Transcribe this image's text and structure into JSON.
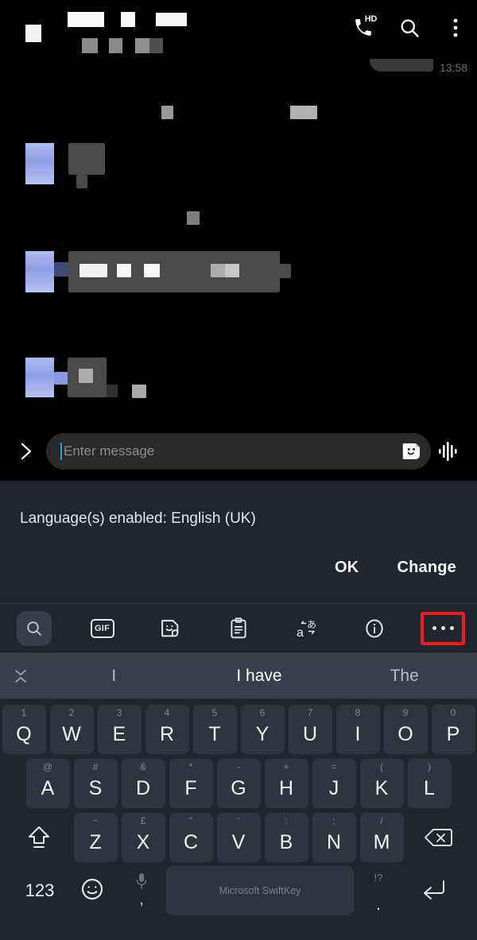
{
  "app": {
    "name": "messaging-app",
    "header": {
      "title_censored": true,
      "subtitle_censored": true,
      "icons": [
        {
          "name": "call-hd-icon",
          "badge": "HD"
        },
        {
          "name": "search-icon"
        },
        {
          "name": "overflow-menu-icon"
        }
      ]
    },
    "conversation": {
      "timestamp": "13:58",
      "messages_censored": true
    },
    "composer": {
      "expand_label": "›",
      "placeholder": "Enter message",
      "value": "",
      "sticker_icon": "sticker-icon",
      "voice_icon": "voice-waveform-icon"
    }
  },
  "keyboard": {
    "name": "Microsoft SwiftKey",
    "language_banner": {
      "message": "Language(s) enabled: English (UK)",
      "ok_label": "OK",
      "change_label": "Change"
    },
    "toolbar": [
      {
        "name": "search-icon",
        "label": "Search",
        "active": true,
        "highlighted": false
      },
      {
        "name": "gif-icon",
        "label": "GIF",
        "active": false,
        "highlighted": false
      },
      {
        "name": "sticker-icon",
        "label": "Stickers",
        "active": false,
        "highlighted": false
      },
      {
        "name": "clipboard-icon",
        "label": "Clipboard",
        "active": false,
        "highlighted": false
      },
      {
        "name": "translate-icon",
        "label": "Translate",
        "active": false,
        "highlighted": false
      },
      {
        "name": "info-icon",
        "label": "Info",
        "active": false,
        "highlighted": false
      },
      {
        "name": "more-options-icon",
        "label": "More",
        "active": false,
        "highlighted": true
      }
    ],
    "highlight_color": "#f01b1b",
    "predictions": {
      "collapse_icon": "collapse-chevron-icon",
      "items": [
        {
          "text": "I",
          "emphasis": false
        },
        {
          "text": "I have",
          "emphasis": true
        },
        {
          "text": "The",
          "emphasis": false
        }
      ]
    },
    "rows": {
      "row1": [
        {
          "main": "Q",
          "alt": "1"
        },
        {
          "main": "W",
          "alt": "2"
        },
        {
          "main": "E",
          "alt": "3"
        },
        {
          "main": "R",
          "alt": "4"
        },
        {
          "main": "T",
          "alt": "5"
        },
        {
          "main": "Y",
          "alt": "6"
        },
        {
          "main": "U",
          "alt": "7"
        },
        {
          "main": "I",
          "alt": "8"
        },
        {
          "main": "O",
          "alt": "9"
        },
        {
          "main": "P",
          "alt": "0"
        }
      ],
      "row2": [
        {
          "main": "A",
          "alt": "@"
        },
        {
          "main": "S",
          "alt": "#"
        },
        {
          "main": "D",
          "alt": "&"
        },
        {
          "main": "F",
          "alt": "*"
        },
        {
          "main": "G",
          "alt": "-"
        },
        {
          "main": "H",
          "alt": "+"
        },
        {
          "main": "J",
          "alt": "="
        },
        {
          "main": "K",
          "alt": "("
        },
        {
          "main": "L",
          "alt": ")"
        }
      ],
      "row3": {
        "shift": "shift-key-icon",
        "letters": [
          {
            "main": "Z",
            "alt": "~"
          },
          {
            "main": "X",
            "alt": "£"
          },
          {
            "main": "C",
            "alt": "\""
          },
          {
            "main": "V",
            "alt": "'"
          },
          {
            "main": "B",
            "alt": ":"
          },
          {
            "main": "N",
            "alt": ";"
          },
          {
            "main": "M",
            "alt": "/"
          }
        ],
        "backspace": "backspace-key-icon"
      },
      "row4": {
        "numeric_label": "123",
        "emoji_icon": "emoji-key-icon",
        "mic_icon": "microphone-icon",
        "comma_label": ",",
        "space_label": "Microsoft SwiftKey",
        "punct_alt_label": "!?",
        "period_label": ".",
        "enter_icon": "enter-key-icon"
      }
    }
  }
}
